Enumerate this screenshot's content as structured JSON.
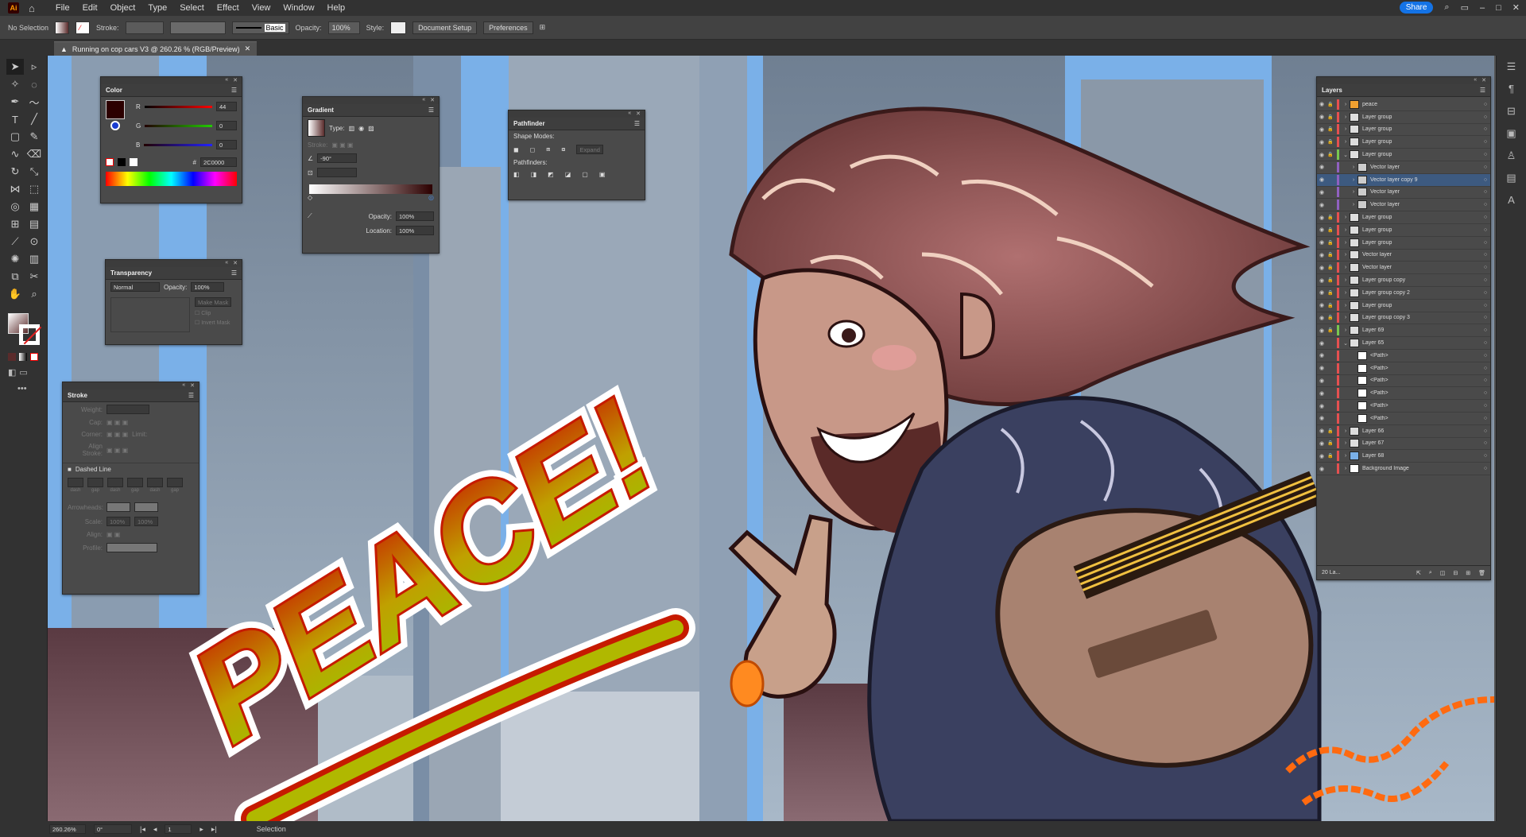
{
  "app": {
    "logo": "Ai"
  },
  "menu": [
    "File",
    "Edit",
    "Object",
    "Type",
    "Select",
    "Effect",
    "View",
    "Window",
    "Help"
  ],
  "topright": {
    "share": "Share"
  },
  "control": {
    "selection": "No Selection",
    "stroke_label": "Stroke:",
    "brush": "Basic",
    "opacity_label": "Opacity:",
    "opacity": "100%",
    "style_label": "Style:",
    "doc_setup": "Document Setup",
    "preferences": "Preferences"
  },
  "document_tab": {
    "title": "Running on cop cars V3 @ 260.26 % (RGB/Preview)"
  },
  "color_panel": {
    "title": "Color",
    "r_label": "R",
    "r": "44",
    "g_label": "G",
    "g": "0",
    "b_label": "B",
    "b": "0",
    "hash": "#",
    "hex": "2C0000",
    "swatch": "#2c0000"
  },
  "gradient_panel": {
    "title": "Gradient",
    "type_label": "Type:",
    "stroke_label": "Stroke:",
    "angle": "-90°",
    "opacity_label": "Opacity:",
    "opacity": "100%",
    "location_label": "Location:",
    "location": "100%"
  },
  "pathfinder_panel": {
    "title": "Pathfinder",
    "shape_modes": "Shape Modes:",
    "expand": "Expand",
    "pathfinders": "Pathfinders:"
  },
  "transparency_panel": {
    "title": "Transparency",
    "mode": "Normal",
    "opacity_label": "Opacity:",
    "opacity": "100%",
    "make_mask": "Make Mask",
    "clip": "Clip",
    "invert_mask": "Invert Mask"
  },
  "stroke_panel": {
    "title": "Stroke",
    "weight": "Weight:",
    "cap": "Cap:",
    "corner": "Corner:",
    "limit": "Limit:",
    "align": "Align Stroke:",
    "dashed": "Dashed Line",
    "dash_labels": [
      "dash",
      "gap",
      "dash",
      "gap",
      "dash",
      "gap"
    ],
    "arrowheads": "Arrowheads:",
    "scale": "Scale:",
    "scale_v1": "100%",
    "scale_v2": "100%",
    "align_arrow": "Align:",
    "profile": "Profile:"
  },
  "layers_panel": {
    "title": "Layers",
    "count": "20 La...",
    "rows": [
      {
        "name": "peace",
        "color": "#e65050",
        "arrow": "›",
        "lock": true,
        "thumb": "#f0a030"
      },
      {
        "name": "Layer group",
        "color": "#e65050",
        "arrow": "›",
        "lock": true,
        "thumb": "#ddd"
      },
      {
        "name": "Layer group",
        "color": "#e65050",
        "arrow": "›",
        "lock": true,
        "thumb": "#ddd"
      },
      {
        "name": "Layer group",
        "color": "#e65050",
        "arrow": "›",
        "lock": true,
        "thumb": "#ddd"
      },
      {
        "name": "Layer group",
        "color": "#78c850",
        "arrow": "⌄",
        "lock": true,
        "thumb": "#ddd"
      },
      {
        "name": "Vector layer",
        "color": "#9060c0",
        "arrow": "›",
        "lock": false,
        "thumb": "#ccc",
        "indent": true
      },
      {
        "name": "Vector layer copy 9",
        "color": "#9060c0",
        "arrow": "›",
        "lock": false,
        "thumb": "#ccc",
        "indent": true,
        "sel": true
      },
      {
        "name": "Vector layer",
        "color": "#9060c0",
        "arrow": "›",
        "lock": false,
        "thumb": "#ccc",
        "indent": true
      },
      {
        "name": "Vector layer",
        "color": "#9060c0",
        "arrow": "›",
        "lock": false,
        "thumb": "#ccc",
        "indent": true
      },
      {
        "name": "Layer group",
        "color": "#e65050",
        "arrow": "›",
        "lock": true,
        "thumb": "#ddd"
      },
      {
        "name": "Layer group",
        "color": "#e65050",
        "arrow": "›",
        "lock": true,
        "thumb": "#ddd"
      },
      {
        "name": "Layer group",
        "color": "#e65050",
        "arrow": "›",
        "lock": true,
        "thumb": "#ddd"
      },
      {
        "name": "Vector layer",
        "color": "#e65050",
        "arrow": "›",
        "lock": true,
        "thumb": "#ddd"
      },
      {
        "name": "Vector layer",
        "color": "#e65050",
        "arrow": "›",
        "lock": true,
        "thumb": "#ddd"
      },
      {
        "name": "Layer group copy",
        "color": "#e65050",
        "arrow": "›",
        "lock": true,
        "thumb": "#ddd"
      },
      {
        "name": "Layer group copy 2",
        "color": "#e65050",
        "arrow": "›",
        "lock": true,
        "thumb": "#ddd"
      },
      {
        "name": "Layer group",
        "color": "#e65050",
        "arrow": "›",
        "lock": true,
        "thumb": "#ddd"
      },
      {
        "name": "Layer group copy 3",
        "color": "#e65050",
        "arrow": "›",
        "lock": true,
        "thumb": "#ddd"
      },
      {
        "name": "Layer 69",
        "color": "#78c850",
        "arrow": "›",
        "lock": true,
        "thumb": "#ddd"
      },
      {
        "name": "Layer 65",
        "color": "#e65050",
        "arrow": "⌄",
        "lock": false,
        "thumb": "#ddd"
      },
      {
        "name": "<Path>",
        "color": "#e65050",
        "arrow": "",
        "lock": false,
        "thumb": "#fff",
        "indent": true
      },
      {
        "name": "<Path>",
        "color": "#e65050",
        "arrow": "",
        "lock": false,
        "thumb": "#fff",
        "indent": true
      },
      {
        "name": "<Path>",
        "color": "#e65050",
        "arrow": "",
        "lock": false,
        "thumb": "#fff",
        "indent": true
      },
      {
        "name": "<Path>",
        "color": "#e65050",
        "arrow": "",
        "lock": false,
        "thumb": "#fff",
        "indent": true
      },
      {
        "name": "<Path>",
        "color": "#e65050",
        "arrow": "",
        "lock": false,
        "thumb": "#fff",
        "indent": true
      },
      {
        "name": "<Path>",
        "color": "#e65050",
        "arrow": "",
        "lock": false,
        "thumb": "#fff",
        "indent": true
      },
      {
        "name": "Layer 66",
        "color": "#e65050",
        "arrow": "›",
        "lock": true,
        "thumb": "#ddd"
      },
      {
        "name": "Layer 67",
        "color": "#e65050",
        "arrow": "›",
        "lock": true,
        "thumb": "#ddd"
      },
      {
        "name": "Layer 68",
        "color": "#e65050",
        "arrow": "›",
        "lock": true,
        "thumb": "#7ab0e8"
      },
      {
        "name": "Background Image",
        "color": "#e65050",
        "arrow": "›",
        "lock": false,
        "thumb": "#fff"
      }
    ]
  },
  "artwork": {
    "text": "PEACE!"
  },
  "status": {
    "zoom": "260.26%",
    "rotation": "0°",
    "artboard": "1",
    "tool": "Selection"
  }
}
